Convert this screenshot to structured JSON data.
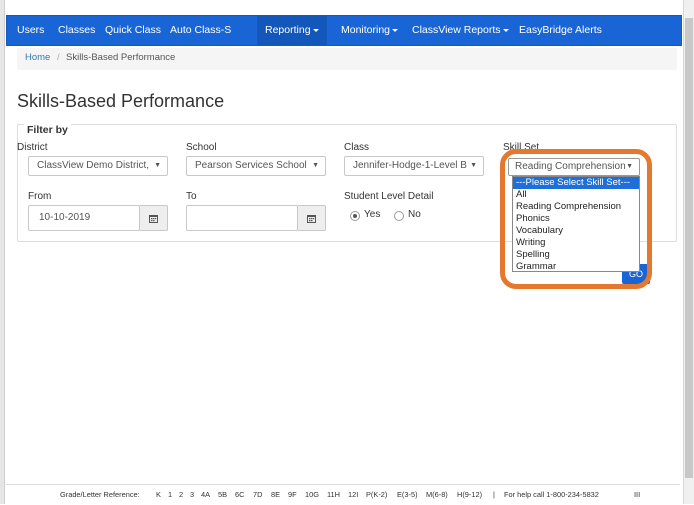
{
  "nav": {
    "items": [
      "Users",
      "Classes",
      "Quick Class",
      "Auto Class-S",
      "Reporting",
      "Monitoring",
      "ClassView Reports",
      "EasyBridge Alerts"
    ]
  },
  "breadcrumb": {
    "home": "Home",
    "separator": "/",
    "current": "Skills-Based Performance"
  },
  "page": {
    "title": "Skills-Based Performance"
  },
  "filter": {
    "legend": "Filter by",
    "district": {
      "label": "District",
      "value": "ClassView Demo District,"
    },
    "school": {
      "label": "School",
      "value": "Pearson Services School"
    },
    "class": {
      "label": "Class",
      "value": "Jennifer-Hodge-1-Level B"
    },
    "skill_set": {
      "label": "Skill Set",
      "value": "Reading Comprehension",
      "options": [
        "---Please Select Skill Set---",
        "All",
        "Reading Comprehension",
        "Phonics",
        "Vocabulary",
        "Writing",
        "Spelling",
        "Grammar"
      ]
    },
    "from": {
      "label": "From",
      "value": "10-10-2019"
    },
    "to": {
      "label": "To",
      "value": ""
    },
    "student_level": {
      "label": "Student Level Detail",
      "yes": "Yes",
      "no": "No"
    },
    "go_label": "GO"
  },
  "footer": {
    "reference_label": "Grade/Letter Reference:",
    "grades": [
      "K",
      "1",
      "2",
      "3",
      "4A",
      "5B",
      "6C",
      "7D",
      "8E",
      "9F",
      "10G",
      "11H",
      "12I",
      "P(K-2)",
      "E(3-5)",
      "M(6-8)",
      "H(9-12)"
    ],
    "separator": "|",
    "help": "For help call 1-800-234-5832",
    "right_mark": "III"
  },
  "colors": {
    "nav_bg": "#1a65d6",
    "highlight": "#e5782e",
    "link": "#337ab7"
  }
}
